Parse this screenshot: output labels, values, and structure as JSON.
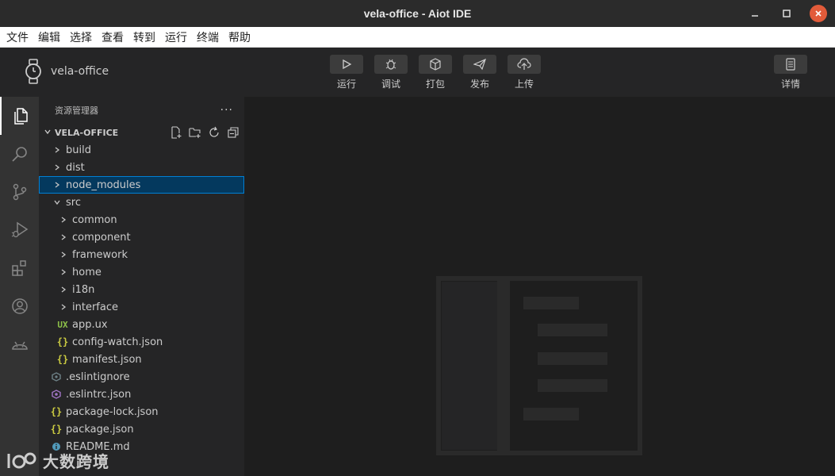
{
  "window": {
    "title": "vela-office - Aiot IDE"
  },
  "menu": [
    "文件",
    "编辑",
    "选择",
    "查看",
    "转到",
    "运行",
    "终端",
    "帮助"
  ],
  "toolbar": {
    "project_name": "vela-office",
    "run": "运行",
    "debug": "调试",
    "pack": "打包",
    "publish": "发布",
    "upload": "上传",
    "details": "详情"
  },
  "explorer": {
    "title": "资源管理器",
    "more": "···",
    "section": "VELA-OFFICE",
    "tree": [
      {
        "label": "build",
        "kind": "folder",
        "depth": 0
      },
      {
        "label": "dist",
        "kind": "folder",
        "depth": 0
      },
      {
        "label": "node_modules",
        "kind": "folder",
        "depth": 0,
        "selected": true
      },
      {
        "label": "src",
        "kind": "folder-open",
        "depth": 0
      },
      {
        "label": "common",
        "kind": "folder",
        "depth": 1
      },
      {
        "label": "component",
        "kind": "folder",
        "depth": 1
      },
      {
        "label": "framework",
        "kind": "folder",
        "depth": 1
      },
      {
        "label": "home",
        "kind": "folder",
        "depth": 1
      },
      {
        "label": "i18n",
        "kind": "folder",
        "depth": 1
      },
      {
        "label": "interface",
        "kind": "folder",
        "depth": 1
      },
      {
        "label": "app.ux",
        "kind": "ux",
        "depth": 1
      },
      {
        "label": "config-watch.json",
        "kind": "json",
        "depth": 1
      },
      {
        "label": "manifest.json",
        "kind": "json",
        "depth": 1
      },
      {
        "label": ".eslintignore",
        "kind": "eslintignore",
        "depth": 0
      },
      {
        "label": ".eslintrc.json",
        "kind": "eslintrc",
        "depth": 0
      },
      {
        "label": "package-lock.json",
        "kind": "json",
        "depth": 0
      },
      {
        "label": "package.json",
        "kind": "json",
        "depth": 0
      },
      {
        "label": "README.md",
        "kind": "info",
        "depth": 0
      }
    ]
  },
  "watermark": {
    "text": "大数跨境"
  },
  "colors": {
    "selection": "#04395e",
    "focus_border": "#007fd4",
    "close_button": "#e25b3a",
    "json_icon": "#cbcb41",
    "ux_icon": "#8dc149",
    "eslint_icon": "#a074c4"
  }
}
